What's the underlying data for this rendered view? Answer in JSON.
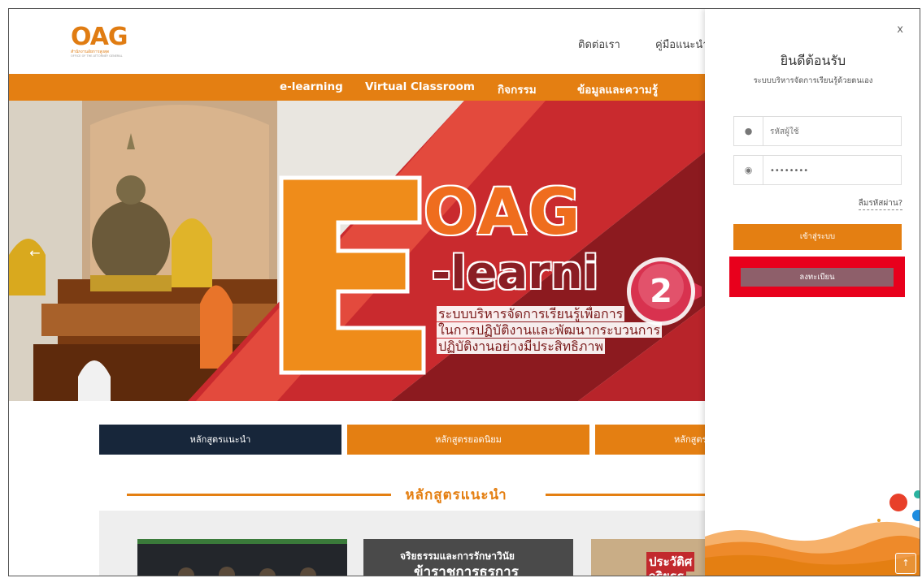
{
  "header": {
    "logo_text": "OAG",
    "logo_subtitle": "สำนักงานอัยการสูงสุด",
    "logo_subtitle_en": "OFFICE OF THE ATTORNEY GENERAL",
    "links": [
      "ติดต่อเรา",
      "คู่มือแนะนำ"
    ]
  },
  "nav": {
    "items": [
      "e-learning",
      "Virtual Classroom",
      "กิจกรรม",
      "ข้อมูลและความรู้"
    ],
    "color": "#e47f12"
  },
  "hero": {
    "big_letter": "E",
    "brand": "OAG",
    "headline": "-learni",
    "lines": [
      "ระบบบริหารจัดการเรียนรู้เพื่อการ",
      "ในการปฏิบัติงานและพัฒนากระบวนการ",
      "ปฏิบัติงานอย่างมีประสิทธิภาพ"
    ],
    "prev_icon": "arrow-left-icon"
  },
  "course_tabs": [
    {
      "label": "หลักสูตรแนะนำ",
      "color": "#17263a"
    },
    {
      "label": "หลักสูตรยอดนิยม",
      "color": "#e47f12"
    },
    {
      "label": "หลักสูตร",
      "color": "#e47f12"
    }
  ],
  "section": {
    "title": "หลักสูตรแนะนำ"
  },
  "course_cards": [
    {
      "caption_1": "",
      "caption_2": ""
    },
    {
      "caption_1": "จริยธรรมและการรักษาวินัย",
      "caption_2": "ข้าราชการธุรการ"
    },
    {
      "caption_1": "ประวัติศ",
      "caption_2": "จริยธร"
    }
  ],
  "login": {
    "close_label": "x",
    "welcome": "ยินดีต้อนรับ",
    "subtitle": "ระบบบริหารจัดการเรียนรู้ด้วยตนเอง",
    "username_placeholder": "รหัสผู้ใช้",
    "password_value": "••••••••",
    "forgot_label": "ลืมรหัสผ่าน?",
    "login_label": "เข้าสู่ระบบ",
    "register_label": "ลงทะเบียน",
    "scroll_top_icon": "arrow-up-icon"
  },
  "step_marker": {
    "number": "2"
  }
}
